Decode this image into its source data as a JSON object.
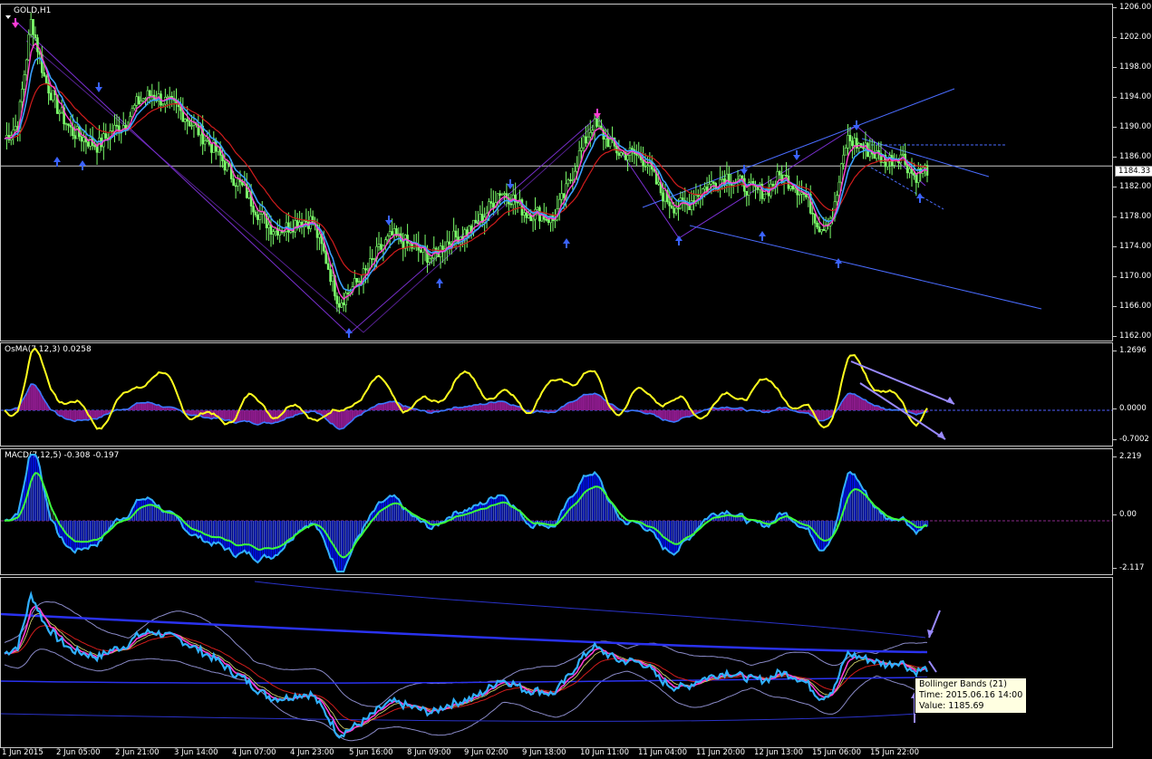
{
  "main_chart": {
    "symbol_label": "GOLD,H1",
    "current_price": "1184.33",
    "price_scale": [
      "1206.00",
      "1202.00",
      "1198.00",
      "1194.00",
      "1190.00",
      "1186.00",
      "1182.00",
      "1178.00",
      "1174.00",
      "1170.00",
      "1166.00",
      "1162.00"
    ]
  },
  "osma": {
    "label": "OsMA(7,12,3) 0.0258",
    "scale": [
      "1.2696",
      "0.0000",
      "-0.7002"
    ],
    "zero_label": "0"
  },
  "macd": {
    "label": "MACD(7,12,5) -0.308 -0.197",
    "scale": [
      "2.219",
      "0.00",
      "-2.117"
    ],
    "zero_label": "0"
  },
  "bollinger": {
    "tooltip_title": "Bollinger Bands (21)",
    "tooltip_time": "Time: 2015.06.16 14:00",
    "tooltip_value": "Value: 1185.69"
  },
  "time_axis": [
    "1 Jun 2015",
    "2 Jun 05:00",
    "2 Jun 21:00",
    "3 Jun 14:00",
    "4 Jun 07:00",
    "4 Jun 23:00",
    "5 Jun 16:00",
    "8 Jun 09:00",
    "9 Jun 02:00",
    "9 Jun 18:00",
    "10 Jun 11:00",
    "11 Jun 04:00",
    "11 Jun 20:00",
    "12 Jun 13:00",
    "15 Jun 06:00",
    "15 Jun 22:00"
  ],
  "colors": {
    "candle": "#7cff6b",
    "ma_fast": "#ff3cd2",
    "ma_mid": "#3aa0ff",
    "ma_slow": "#d01c1c",
    "trendline": "#4a6cff",
    "zigzag": "#7a2fd0",
    "osma_line": "#ffff1e",
    "osma_hist": "#8a1a8a",
    "macd_main": "#30b0ff",
    "macd_signal": "#3cff3c",
    "macd_hist": "#0010e0"
  },
  "price_path": [
    1188,
    1190,
    1204,
    1196,
    1192,
    1189,
    1188,
    1187,
    1189,
    1190,
    1193,
    1194,
    1193,
    1192,
    1190,
    1188,
    1186,
    1183,
    1181,
    1178,
    1176,
    1176,
    1177,
    1177,
    1172,
    1166,
    1168,
    1170,
    1173,
    1175,
    1174,
    1173,
    1172,
    1174,
    1175,
    1176,
    1178,
    1181,
    1180,
    1178,
    1178,
    1177,
    1181,
    1186,
    1190,
    1188,
    1186,
    1186,
    1185,
    1181,
    1179,
    1179,
    1181,
    1182,
    1183,
    1182,
    1181,
    1181,
    1183,
    1182,
    1180,
    1176,
    1178,
    1188,
    1187,
    1186,
    1185,
    1186,
    1183,
    1184
  ]
}
